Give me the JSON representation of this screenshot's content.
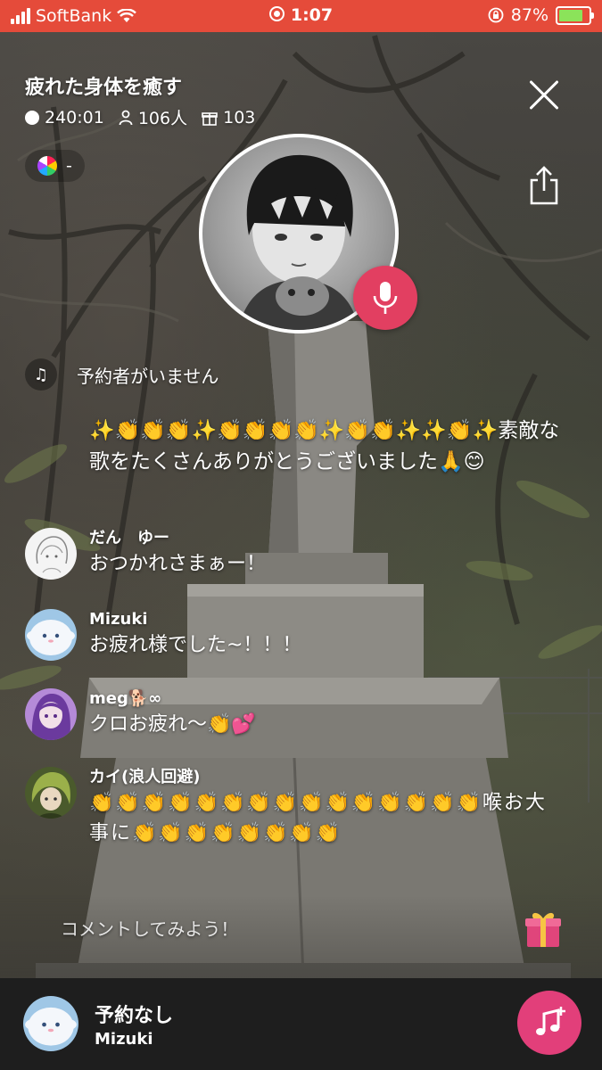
{
  "status_bar": {
    "carrier": "SoftBank",
    "time": "1:07",
    "battery": "87%",
    "battery_level": 0.87
  },
  "room": {
    "title": "疲れた身体を癒す",
    "duration": "240:01",
    "listeners": "106人",
    "gifts": "103",
    "genre": "-"
  },
  "queue": {
    "label": "予約者がいません"
  },
  "system_message": {
    "text": "✨👏👏👏✨👏👏👏👏✨👏👏✨✨👏✨素敵な歌をたくさんありがとうございました🙏😊"
  },
  "messages": [
    {
      "name": "だん　ゆー",
      "text": "おつかれさまぁー！"
    },
    {
      "name": "Mizuki",
      "text": "お疲れ様でした~！！！"
    },
    {
      "name": "meg🐕∞",
      "text": "クロお疲れ〜👏💕"
    },
    {
      "name": "カイ(浪人回避)",
      "text": "👏👏👏👏👏👏👏👏👏👏👏👏👏👏👏喉お大事に👏👏👏👏👏👏👏👏"
    }
  ],
  "comment": {
    "placeholder": "コメントしてみよう！"
  },
  "player": {
    "title": "予約なし",
    "user": "Mizuki"
  },
  "colors": {
    "status_bar": "#e54b3a",
    "mic_button": "#e23f61",
    "music_button": "#e23f7a",
    "player_bg": "#1e1e1e"
  },
  "icons": {
    "close": "close-icon",
    "share": "share-icon",
    "mic": "microphone-icon",
    "gift": "gift-icon",
    "music": "music-add-icon",
    "queue": "music-note-icon"
  }
}
